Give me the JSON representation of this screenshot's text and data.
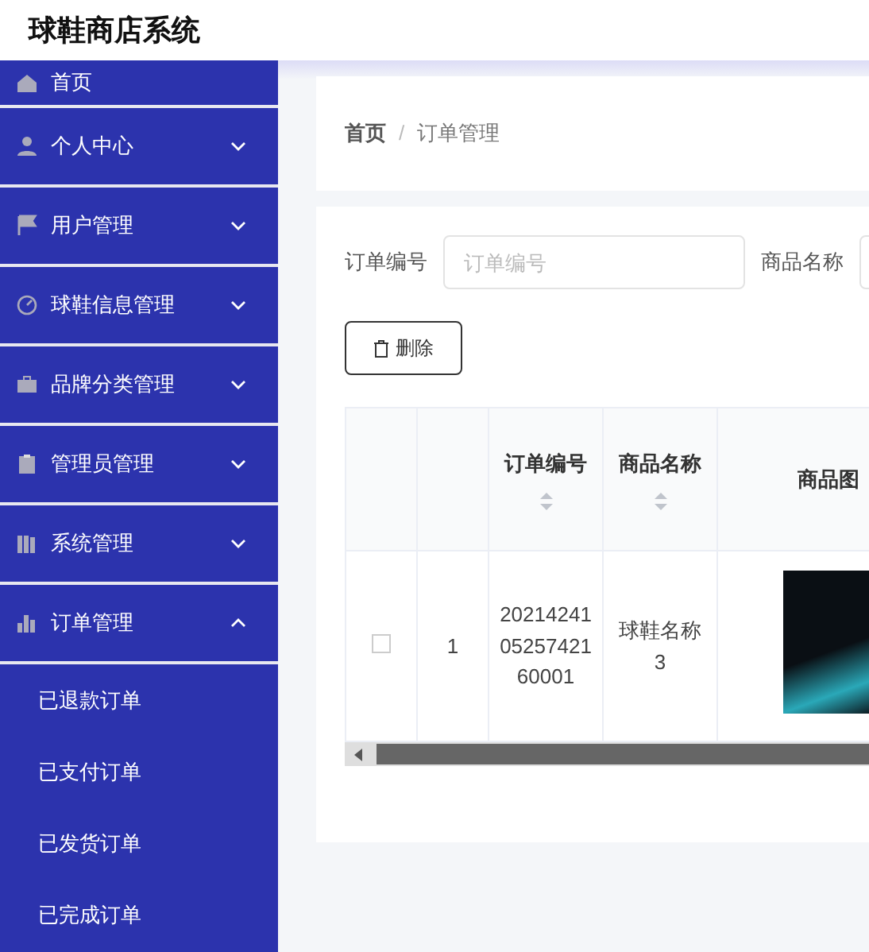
{
  "header": {
    "title": "球鞋商店系统"
  },
  "sidebar": {
    "items": [
      {
        "label": "首页"
      },
      {
        "label": "个人中心",
        "expanded": false
      },
      {
        "label": "用户管理",
        "expanded": false
      },
      {
        "label": "球鞋信息管理",
        "expanded": false
      },
      {
        "label": "品牌分类管理",
        "expanded": false
      },
      {
        "label": "管理员管理",
        "expanded": false
      },
      {
        "label": "系统管理",
        "expanded": false
      },
      {
        "label": "订单管理",
        "expanded": true,
        "children": [
          {
            "label": "已退款订单"
          },
          {
            "label": "已支付订单"
          },
          {
            "label": "已发货订单"
          },
          {
            "label": "已完成订单"
          }
        ]
      }
    ]
  },
  "breadcrumb": {
    "items": [
      "首页",
      "订单管理"
    ],
    "separator": "/"
  },
  "search": {
    "fields": [
      {
        "label": "订单编号",
        "placeholder": "订单编号"
      },
      {
        "label": "商品名称"
      }
    ]
  },
  "actions": [
    {
      "label": "删除"
    }
  ],
  "table": {
    "columns": [
      {
        "kind": "check"
      },
      {
        "kind": "index"
      },
      {
        "kind": "text",
        "label": "订单编号",
        "sortable": true
      },
      {
        "kind": "text",
        "label": "商品名称",
        "sortable": true
      },
      {
        "kind": "image",
        "label": "商品图"
      }
    ],
    "rows": [
      {
        "checked": false,
        "cells": [
          "",
          "1",
          "202142410525742160001",
          "球鞋名称3",
          ""
        ]
      }
    ]
  }
}
